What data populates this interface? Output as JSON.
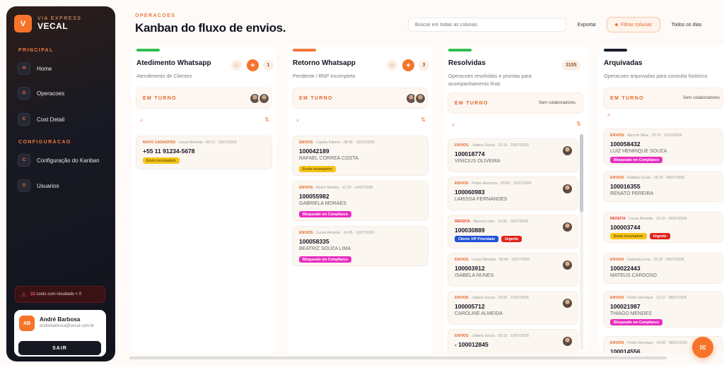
{
  "brand": {
    "logo_letter": "V",
    "subtitle": "VIA EXPRESS",
    "name": "VECAL"
  },
  "sidebar": {
    "section_principal": "PRINCIPAL",
    "items_principal": [
      {
        "letter": "H",
        "label": "Home"
      },
      {
        "letter": "O",
        "label": "Operacoes"
      },
      {
        "letter": "C",
        "label": "Cost Detail"
      }
    ],
    "section_config": "CONFIGURACAO",
    "items_config": [
      {
        "letter": "C",
        "label": "Configuração do Kanban"
      },
      {
        "letter": "U",
        "label": "Usuarios"
      }
    ],
    "alert": {
      "count": "22",
      "text": "costs com resultado < 0"
    },
    "user": {
      "initials": "AB",
      "name": "André Barbosa",
      "email": "andrebarbosa@vecal.com.br",
      "logout": "SAIR"
    }
  },
  "header": {
    "kicker": "OPERACOES",
    "title": "Kanban do fluxo de envios.",
    "search_placeholder": "Buscar em todas as colunas",
    "export": "Exportar",
    "filter": "Filtrar colunas",
    "all_days": "Todos os dias"
  },
  "colors": {
    "accent": "#f5742a",
    "green": "#2fbf4f",
    "orange": "#f07a3c",
    "navy": "#1b1c2e"
  },
  "columns": [
    {
      "title": "Atedimento Whatsapp",
      "desc": "Atendimento de Clientes",
      "count": "1",
      "turno": "EM TURNO",
      "cards": [
        {
          "tag": "NOVO CADASTRO",
          "who": "Lucas Almeida",
          "time": "09:12",
          "date": "15/07/2026",
          "id": "+55 11 91234-5678",
          "name": "",
          "badges": [
            "Envio incompleto"
          ]
        }
      ]
    },
    {
      "title": "Retorno Whatsapp",
      "desc": "Pendente / BNP Incompleto",
      "count": "3",
      "turno": "EM TURNO",
      "cards": [
        {
          "tag": "ENVIOS",
          "who": "Camila Ribeiro",
          "time": "08:45",
          "date": "15/07/2026",
          "id": "100042189",
          "name": "RAFAEL CORREA COSTA",
          "badges": [
            "Envio incompleto"
          ]
        },
        {
          "tag": "ENVIOS",
          "who": "Bruno Martins",
          "time": "11:20",
          "date": "14/07/2026",
          "id": "100055982",
          "name": "GABRIELA MORAES",
          "badges": [
            "Bloqueado em Compliance"
          ]
        },
        {
          "tag": "ENVIOS",
          "who": "Lucas Almeida",
          "time": "14:05",
          "date": "10/07/2026",
          "id": "100058335",
          "name": "BEATRIZ SOUZA LIMA",
          "badges": [
            "Bloqueado em Compliance"
          ]
        }
      ]
    },
    {
      "title": "Resolvidas",
      "desc": "Operacoes resolvidas e prontas para acompanhamento final.",
      "count": "3155",
      "turno": "EM TURNO",
      "turno_right": "Sem colaboradores",
      "cards": [
        {
          "tag": "ENVIOS",
          "who": "Juliana Souza",
          "time": "10:15",
          "date": "15/07/2026",
          "id": "100018774",
          "name": "VINICIUS OLIVEIRA",
          "badges": []
        },
        {
          "tag": "ENVIOS",
          "who": "Pedro Henrique",
          "time": "09:50",
          "date": "15/07/2026",
          "id": "100060983",
          "name": "LARISSA FERNANDES",
          "badges": []
        },
        {
          "tag": "REFEITA",
          "who": "Marcos Lima",
          "time": "10:35",
          "date": "15/07/2026",
          "id": "100030889",
          "name": "",
          "badges": [
            "Cliente VIP Prioridade",
            "Urgente"
          ]
        },
        {
          "tag": "ENVIOS",
          "who": "Lucas Almeida",
          "time": "09:40",
          "date": "15/07/2026",
          "id": "100003912",
          "name": "ISABELA NUNES",
          "badges": []
        },
        {
          "tag": "ENVIOS",
          "who": "Juliana Souza",
          "time": "10:05",
          "date": "15/07/2026",
          "id": "100005712",
          "name": "CAROLINE ALMEIDA",
          "badges": []
        },
        {
          "tag": "ENVIOS",
          "who": "Juliana Souza",
          "time": "09:15",
          "date": "15/07/2026",
          "id": "- 100012845",
          "name": "",
          "badges": []
        }
      ]
    },
    {
      "title": "Arquivadas",
      "desc": "Operacoes arquivadas para consulta histórica",
      "turno": "EM TURNO",
      "turno_right": "Sem colaboradores",
      "cards": [
        {
          "tag": "ENVIOS",
          "who": "Marcos Silva",
          "time": "15:10",
          "date": "11/07/2026",
          "id": "100058432",
          "name": "LUIZ HENRIQUE SOUZA",
          "badges": [
            "Bloqueado em Compliance"
          ]
        },
        {
          "tag": "ENVIOS",
          "who": "Rafaela Costa",
          "time": "16:15",
          "date": "09/07/2026",
          "id": "100016355",
          "name": "RENATO PEREIRA",
          "badges": []
        },
        {
          "tag": "REFEITA",
          "who": "Lucas Almeida",
          "time": "15:19",
          "date": "09/07/2026",
          "id": "100003744",
          "name": "",
          "badges": [
            "Envio incompleto",
            "Urgente"
          ]
        },
        {
          "tag": "ENVIOS",
          "who": "Gabriela Lima",
          "time": "15:18",
          "date": "09/07/2026",
          "id": "100022443",
          "name": "MATEUS CARDOSO",
          "badges": []
        },
        {
          "tag": "ENVIOS",
          "who": "Pedro Henrique",
          "time": "11:12",
          "date": "08/07/2026",
          "id": "100021987",
          "name": "THIAGO MENDES",
          "badges": [
            "Bloqueado em Compliance"
          ]
        },
        {
          "tag": "ENVIOS",
          "who": "Pedro Henrique",
          "time": "10:00",
          "date": "08/07/2026",
          "id": "100014556",
          "name": "",
          "badges": []
        }
      ]
    }
  ]
}
